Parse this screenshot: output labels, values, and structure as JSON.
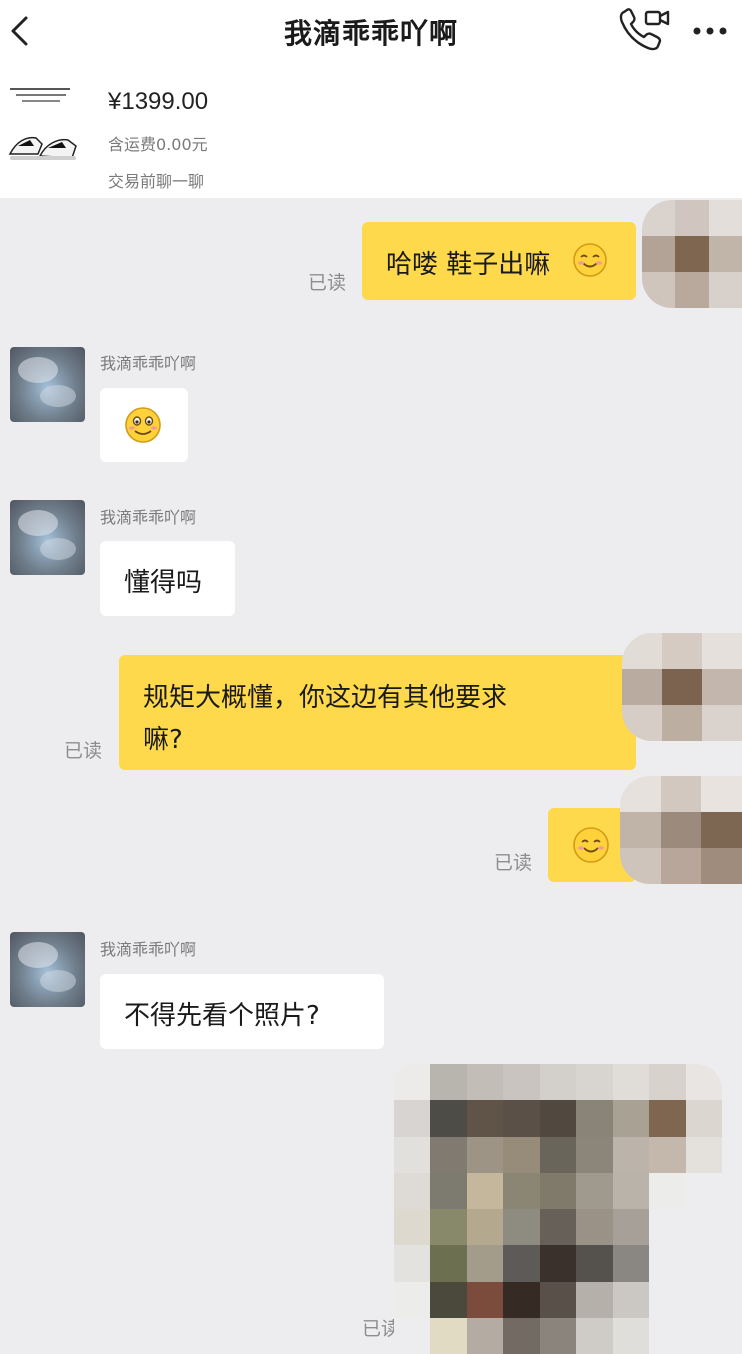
{
  "header": {
    "title": "我滴乖乖吖啊",
    "back_icon": "chevron-left-icon",
    "call_icon": "phone-video-icon",
    "more_icon": "more-dots-icon"
  },
  "product": {
    "price": "¥1399.00",
    "shipping": "含运费0.00元",
    "note": "交易前聊一聊"
  },
  "contact": {
    "nickname": "我滴乖乖吖啊"
  },
  "messages": [
    {
      "side": "right",
      "text": "哈喽 鞋子出嘛",
      "status": "已读"
    },
    {
      "side": "left",
      "sender": "我滴乖乖吖啊",
      "type": "emoji"
    },
    {
      "side": "left",
      "sender": "我滴乖乖吖啊",
      "text": "懂得吗"
    },
    {
      "side": "right",
      "text_line1": "规矩大概懂，你这边有其他要求",
      "text_line2": "嘛?",
      "status": "已读"
    },
    {
      "side": "right",
      "type": "emoji",
      "status": "已读"
    },
    {
      "side": "left",
      "sender": "我滴乖乖吖啊",
      "text": "不得先看个照片?"
    },
    {
      "side": "right",
      "type": "image",
      "status": "已读"
    }
  ],
  "colors": {
    "background": "#ededef",
    "my_bubble": "#fdd94b",
    "their_bubble": "#ffffff",
    "status_text": "#8d8d8d"
  }
}
